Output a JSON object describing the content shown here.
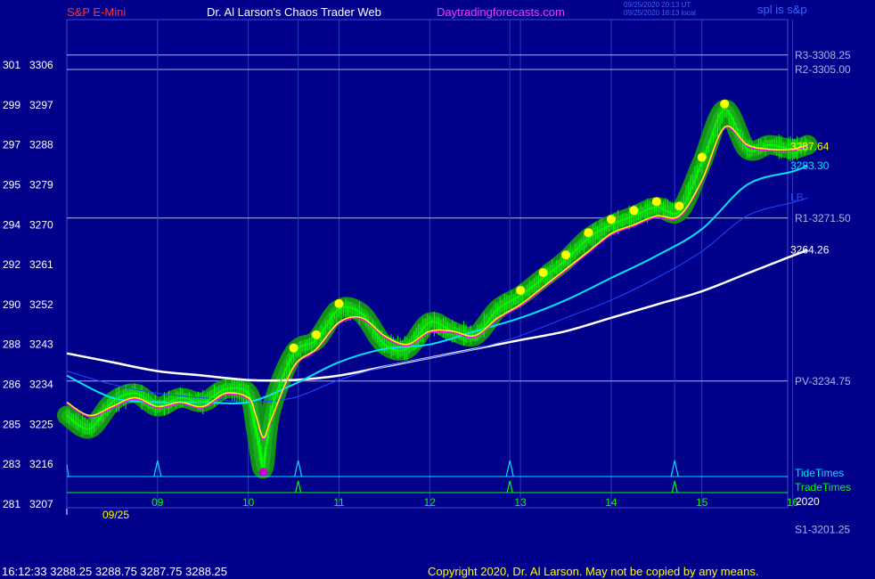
{
  "header": {
    "symbol": "S&P E-Mini",
    "site_title": "Dr. Al Larson's Chaos Trader Web",
    "site_url": "Daytradingforecasts.com",
    "timestamp_utc": "09/25/2020 20:13 UT",
    "timestamp_local": "09/25/2020 16:13 local",
    "sp_label": "spl is s&p"
  },
  "footer": {
    "quote": "16:12:33  3288.25  3288.75  3287.75  3288.25",
    "copyright": "Copyright 2020, Dr. Al Larson. May not be copied by any means."
  },
  "colors": {
    "background": "#00008b",
    "price_bars": "#00ff00",
    "glow": "#109a10",
    "ema_fast": "#ffff00",
    "ema_mid": "#ff00ff",
    "avg_cyan": "#00e5ff",
    "avg_blue": "#1e4bff",
    "avg_white": "#ffffff",
    "levels": "#a8b8e0",
    "tide_line": "#00e5ff",
    "trade_line": "#00ff00",
    "title_red": "#ff3030",
    "title_magenta": "#ff33ff"
  },
  "chart_data": {
    "type": "line",
    "x_label_dates": [
      "09",
      "10",
      "11",
      "12",
      "13",
      "14",
      "15",
      "16"
    ],
    "date_caption": "09/25",
    "year_label": "2020",
    "y_range": [
      3207,
      3310
    ],
    "y_ticks": [
      {
        "left": "301",
        "right": "3306",
        "value": 3306
      },
      {
        "left": "299",
        "right": "3297",
        "value": 3297
      },
      {
        "left": "297",
        "right": "3288",
        "value": 3288
      },
      {
        "left": "295",
        "right": "3279",
        "value": 3279
      },
      {
        "left": "294",
        "right": "3270",
        "value": 3270
      },
      {
        "left": "292",
        "right": "3261",
        "value": 3261
      },
      {
        "left": "290",
        "right": "3252",
        "value": 3252
      },
      {
        "left": "288",
        "right": "3243",
        "value": 3243
      },
      {
        "left": "286",
        "right": "3234",
        "value": 3234
      },
      {
        "left": "285",
        "right": "3225",
        "value": 3225
      },
      {
        "left": "283",
        "right": "3216",
        "value": 3216
      },
      {
        "left": "281",
        "right": "3207",
        "value": 3207
      }
    ],
    "levels": [
      {
        "label": "R3-3308.25",
        "value": 3308.25
      },
      {
        "label": "R2-3305.00",
        "value": 3305.0
      },
      {
        "label": "R1-3271.50",
        "value": 3271.5
      },
      {
        "label": "PV-3234.75",
        "value": 3234.75
      },
      {
        "label": "S1-3201.25",
        "value": 3201.25
      }
    ],
    "last_labels": [
      {
        "text": "3287.64",
        "value": 3287.6,
        "color": "#ffff00"
      },
      {
        "text": "3283.30",
        "value": 3283.3,
        "color": "#00e5ff"
      },
      {
        "text": "LB",
        "value": 3276.2,
        "color": "#1e4bff"
      },
      {
        "text": "3264.26",
        "value": 3264.3,
        "color": "#ffffff"
      }
    ],
    "tide_label": "TideTimes",
    "trade_label": "TradeTimes",
    "tide_times": [
      "09:00",
      "10:33",
      "12:53",
      "14:42"
    ],
    "trade_times": [
      "10:33",
      "12:53",
      "14:42"
    ],
    "series": [
      {
        "color": "#00ff00",
        "x": [
          "08:00",
          "08:15",
          "08:30",
          "08:45",
          "09:00",
          "09:15",
          "09:30",
          "09:45",
          "10:00",
          "10:05",
          "10:10",
          "10:15",
          "10:30",
          "10:45",
          "11:00",
          "11:15",
          "11:30",
          "11:45",
          "12:00",
          "12:15",
          "12:30",
          "12:45",
          "13:00",
          "13:15",
          "13:30",
          "13:45",
          "14:00",
          "14:15",
          "14:30",
          "14:45",
          "15:00",
          "15:15",
          "15:30",
          "15:45",
          "16:00",
          "16:10"
        ],
        "values": [
          3227,
          3224,
          3230,
          3232,
          3229,
          3231,
          3230,
          3233,
          3232,
          3224,
          3215,
          3228,
          3241,
          3244,
          3251,
          3250,
          3243,
          3242,
          3248,
          3246,
          3245,
          3251,
          3254,
          3258,
          3262,
          3267,
          3270,
          3272,
          3274,
          3273,
          3284,
          3296,
          3287,
          3288,
          3287,
          3288
        ]
      },
      {
        "color": "#ffff00",
        "x": [
          "08:00",
          "08:15",
          "08:30",
          "08:45",
          "09:00",
          "09:15",
          "09:30",
          "09:45",
          "10:00",
          "10:05",
          "10:10",
          "10:15",
          "10:30",
          "10:45",
          "11:00",
          "11:15",
          "11:30",
          "11:45",
          "12:00",
          "12:15",
          "12:30",
          "12:45",
          "13:00",
          "13:15",
          "13:30",
          "13:45",
          "14:00",
          "14:15",
          "14:30",
          "14:45",
          "15:00",
          "15:15",
          "15:30",
          "15:45",
          "16:00",
          "16:10"
        ],
        "values": [
          3230,
          3227,
          3229,
          3231,
          3229,
          3230,
          3229,
          3232,
          3231,
          3227,
          3222,
          3226,
          3238,
          3242,
          3248,
          3249,
          3245,
          3243,
          3246,
          3246,
          3245,
          3249,
          3252,
          3256,
          3260,
          3264,
          3268,
          3270,
          3272,
          3272,
          3280,
          3292,
          3288,
          3287,
          3287,
          3288
        ]
      },
      {
        "color": "#00e5ff",
        "x": [
          "08:00",
          "08:30",
          "09:00",
          "09:30",
          "10:00",
          "10:30",
          "11:00",
          "11:30",
          "12:00",
          "12:30",
          "13:00",
          "13:30",
          "14:00",
          "14:30",
          "15:00",
          "15:30",
          "16:00",
          "16:10"
        ],
        "values": [
          3236,
          3231,
          3230,
          3230,
          3230,
          3234,
          3239,
          3242,
          3243,
          3246,
          3249,
          3253,
          3258,
          3263,
          3269,
          3279,
          3282,
          3283.3
        ]
      },
      {
        "color": "#1e4bff",
        "x": [
          "08:00",
          "08:30",
          "09:00",
          "09:30",
          "10:00",
          "10:30",
          "11:00",
          "11:30",
          "12:00",
          "12:30",
          "13:00",
          "13:30",
          "14:00",
          "14:30",
          "15:00",
          "15:30",
          "16:00",
          "16:10"
        ],
        "values": [
          3237,
          3234,
          3232,
          3231,
          3230,
          3231,
          3235,
          3238,
          3240,
          3242,
          3245,
          3249,
          3253,
          3258,
          3264,
          3272,
          3275,
          3276
        ]
      },
      {
        "color": "#ffffff",
        "x": [
          "08:00",
          "08:30",
          "09:00",
          "09:30",
          "10:00",
          "10:30",
          "11:00",
          "11:30",
          "12:00",
          "12:30",
          "13:00",
          "13:30",
          "14:00",
          "14:30",
          "15:00",
          "15:30",
          "16:00",
          "16:10"
        ],
        "values": [
          3241,
          3239,
          3237,
          3236,
          3235,
          3235,
          3236,
          3238,
          3240,
          3242,
          3244,
          3246,
          3249,
          3252,
          3255,
          3259,
          3263,
          3264.3
        ]
      }
    ]
  }
}
